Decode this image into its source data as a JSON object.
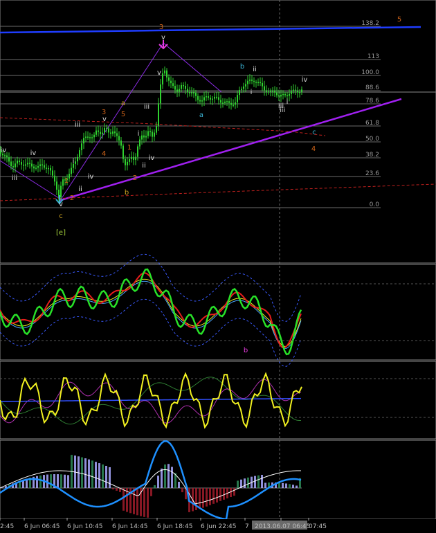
{
  "colors": {
    "background": "#000000",
    "candle": "#2fd12f",
    "grid": "#3a3a3a",
    "fib_line": "#6b6b6b",
    "trend_blue": "#1f3dff",
    "trend_violet": "#a020f0",
    "dashed_red": "#c0201e",
    "wave_orange": "#d4661a",
    "wave_white": "#dddddd",
    "wave_cyan": "#3ab0d0",
    "wave_magenta": "#e83be0",
    "wave_gold": "#c9a020",
    "label_e": "#a4d13c",
    "osc_green": "#28e228",
    "osc_red": "#e81c1c",
    "osc_yellow": "#f0f020",
    "osc_blue": "#3050ff",
    "hist_green": "#2e8b57",
    "hist_red": "#a01c2a",
    "hist_lavender": "#a9a9ff"
  },
  "chart_data": [
    {
      "type": "candlestick",
      "panel": "main",
      "fib_levels": [
        "138.2",
        "113",
        "100.0",
        "88.6",
        "78.6",
        "61.8",
        "50.0",
        "38.2",
        "23.6",
        "0.0"
      ],
      "wave_labels": [
        {
          "text": "3",
          "color": "orange"
        },
        {
          "text": "5",
          "color": "orange"
        },
        {
          "text": "v",
          "color": "white"
        },
        {
          "text": "b",
          "color": "cyan"
        },
        {
          "text": "ii",
          "color": "white"
        },
        {
          "text": "iv",
          "color": "white"
        },
        {
          "text": "a",
          "color": "cyan"
        },
        {
          "text": "i",
          "color": "white"
        },
        {
          "text": "iii",
          "color": "white"
        },
        {
          "text": "c",
          "color": "cyan"
        },
        {
          "text": "4",
          "color": "orange"
        },
        {
          "text": "a",
          "color": "gold"
        },
        {
          "text": "5",
          "color": "orange"
        },
        {
          "text": "3",
          "color": "orange"
        },
        {
          "text": "v",
          "color": "white"
        },
        {
          "text": "iii",
          "color": "white"
        },
        {
          "text": "4",
          "color": "orange"
        },
        {
          "text": "1",
          "color": "orange"
        },
        {
          "text": "i",
          "color": "white"
        },
        {
          "text": "iii",
          "color": "white"
        },
        {
          "text": "ii",
          "color": "white"
        },
        {
          "text": "iv",
          "color": "white"
        },
        {
          "text": "iv",
          "color": "white"
        },
        {
          "text": "ii",
          "color": "white"
        },
        {
          "text": "i",
          "color": "white"
        },
        {
          "text": "iii",
          "color": "white"
        },
        {
          "text": "iv",
          "color": "white"
        },
        {
          "text": "2",
          "color": "orange"
        },
        {
          "text": "b",
          "color": "gold"
        },
        {
          "text": "1",
          "color": "orange"
        },
        {
          "text": "2",
          "color": "orange"
        },
        {
          "text": "v",
          "color": "white"
        },
        {
          "text": "c",
          "color": "gold"
        },
        {
          "text": "[e]",
          "color": "green"
        },
        {
          "text": "iii",
          "color": "white"
        },
        {
          "text": "i",
          "color": "white"
        },
        {
          "text": "iv",
          "color": "white"
        },
        {
          "text": "v",
          "color": "white"
        }
      ],
      "grid": true
    },
    {
      "type": "line",
      "panel": "oscillator_1",
      "label": "b",
      "series_colors": [
        "green",
        "red",
        "yellow",
        "lightblue",
        "blue-dashed"
      ]
    },
    {
      "type": "line",
      "panel": "oscillator_2",
      "series_colors": [
        "yellow",
        "blue",
        "green",
        "magenta",
        "grey-dashed"
      ]
    },
    {
      "type": "bar",
      "panel": "histogram",
      "series_colors": [
        "green",
        "red",
        "lavender",
        "white",
        "blue"
      ]
    }
  ],
  "main": {
    "highlight_label": "[e]",
    "top_right_label": "5",
    "b_label": "b"
  },
  "time_axis": {
    "labels": [
      "2:45",
      "6 Jun 06:45",
      "6 Jun 10:45",
      "6 Jun 14:45",
      "6 Jun 18:45",
      "6 Jun 22:45",
      "7",
      "2013.06.07 06:45",
      "07:45"
    ]
  }
}
